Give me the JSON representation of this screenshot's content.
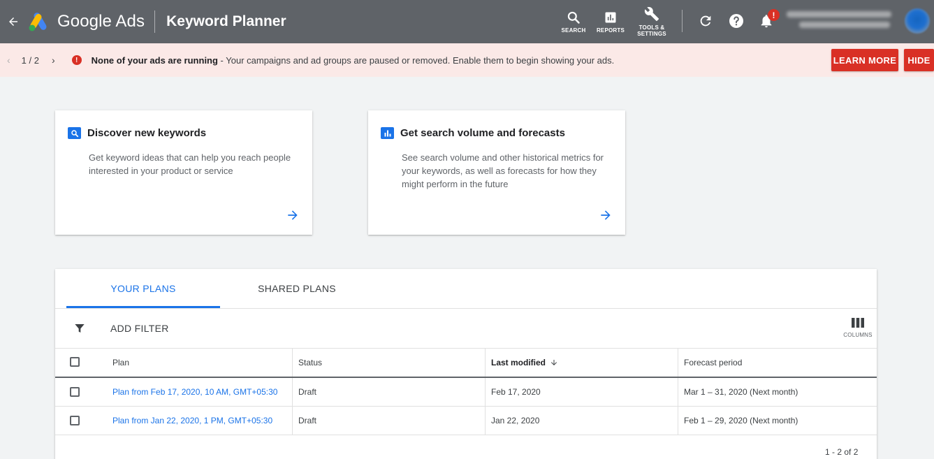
{
  "header": {
    "brand": "Google Ads",
    "page_title": "Keyword Planner",
    "tools": [
      {
        "label": "SEARCH"
      },
      {
        "label": "REPORTS"
      },
      {
        "label": "TOOLS &\nSETTINGS"
      }
    ],
    "notification_badge": "!"
  },
  "notice": {
    "page_count": "1 / 2",
    "message_bold": "None of your ads are running",
    "message_rest": " - Your campaigns and ad groups are paused or removed. Enable them to begin showing your ads.",
    "learn_more": "LEARN MORE",
    "hide": "HIDE"
  },
  "cards": [
    {
      "title": "Discover new keywords",
      "description": "Get keyword ideas that can help you reach people interested in your product or service"
    },
    {
      "title": "Get search volume and forecasts",
      "description": "See search volume and other historical metrics for your keywords, as well as forecasts for how they might perform in the future"
    }
  ],
  "plans": {
    "tabs": [
      "YOUR PLANS",
      "SHARED PLANS"
    ],
    "add_filter": "ADD FILTER",
    "columns_label": "COLUMNS",
    "headers": {
      "plan": "Plan",
      "status": "Status",
      "last_modified": "Last modified",
      "forecast_period": "Forecast period"
    },
    "rows": [
      {
        "plan": "Plan from Feb 17, 2020, 10 AM, GMT+05:30",
        "status": "Draft",
        "last_modified": "Feb 17, 2020",
        "forecast_period": "Mar 1 – 31, 2020 (Next month)"
      },
      {
        "plan": "Plan from Jan 22, 2020, 1 PM, GMT+05:30",
        "status": "Draft",
        "last_modified": "Jan 22, 2020",
        "forecast_period": "Feb 1 – 29, 2020 (Next month)"
      }
    ],
    "pagination": "1 - 2 of 2"
  },
  "colors": {
    "header_bg": "#5f6368",
    "notice_bg": "#fbe9e7",
    "accent_red": "#d93025",
    "accent_blue": "#1a73e8"
  }
}
